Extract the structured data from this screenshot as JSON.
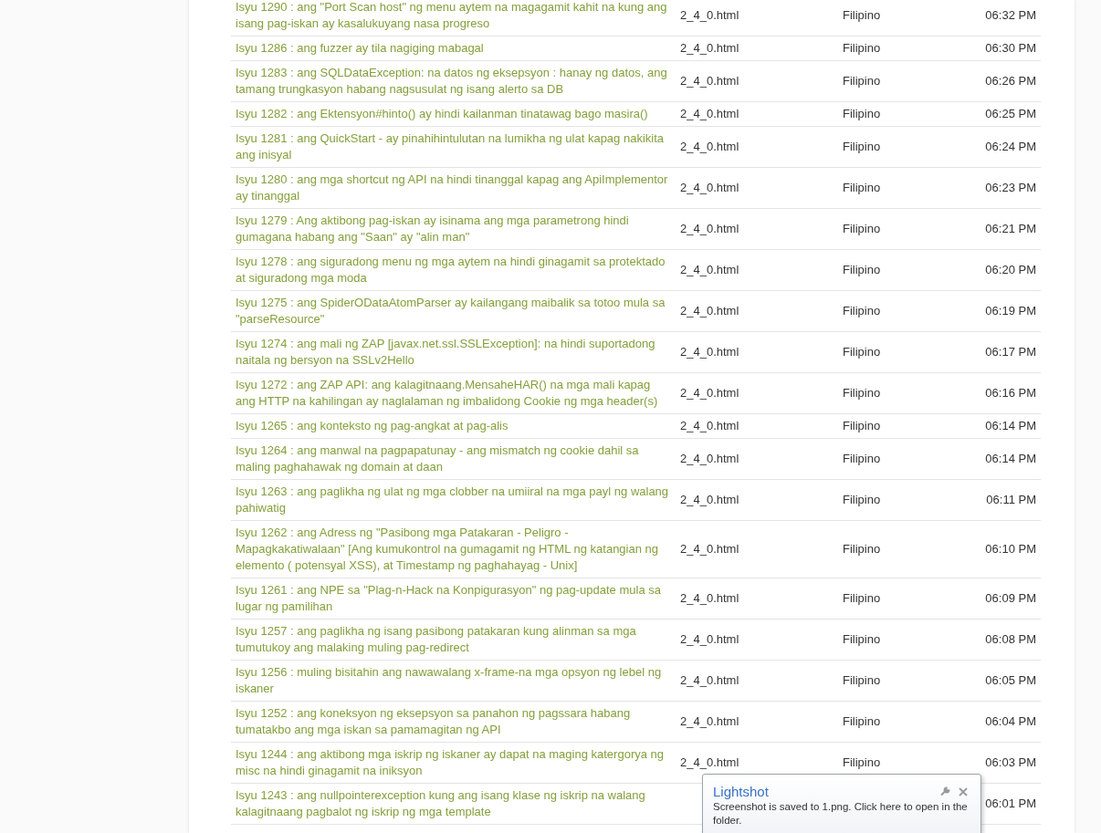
{
  "rows": [
    {
      "title": "Isyu 1290 : ang \"Port Scan host\" ng menu aytem na magagamit kahit na kung ang isang pag-iskan ay kasalukuyang nasa progreso",
      "file": "2_4_0.html",
      "language": "Filipino",
      "time": "06:32 PM"
    },
    {
      "title": "Isyu 1286 : ang fuzzer ay tila nagiging mabagal",
      "file": "2_4_0.html",
      "language": "Filipino",
      "time": "06:30 PM"
    },
    {
      "title": "Isyu 1283 : ang SQLDataException: na datos ng eksepsyon : hanay ng datos, ang tamang trungkasyon habang nagsusulat ng isang alerto sa DB",
      "file": "2_4_0.html",
      "language": "Filipino",
      "time": "06:26 PM"
    },
    {
      "title": "Isyu 1282 : ang Ektensyon#hinto() ay hindi kailanman tinatawag bago masira()",
      "file": "2_4_0.html",
      "language": "Filipino",
      "time": "06:25 PM"
    },
    {
      "title": "Isyu 1281 : ang QuickStart - ay pinahihintulutan na lumikha ng ulat kapag nakikita ang inisyal",
      "file": "2_4_0.html",
      "language": "Filipino",
      "time": "06:24 PM"
    },
    {
      "title": "Isyu 1280 : ang mga shortcut ng API na hindi tinanggal kapag ang ApiImplementor ay tinanggal",
      "file": "2_4_0.html",
      "language": "Filipino",
      "time": "06:23 PM"
    },
    {
      "title": "Isyu 1279 : Ang aktibong pag-iskan ay isinama ang mga parametrong hindi gumagana habang ang \"Saan\" ay \"alin man\"",
      "file": "2_4_0.html",
      "language": "Filipino",
      "time": "06:21 PM"
    },
    {
      "title": "Isyu 1278 : ang siguradong menu ng mga aytem na hindi ginagamit sa protektado at siguradong mga moda",
      "file": "2_4_0.html",
      "language": "Filipino",
      "time": "06:20 PM"
    },
    {
      "title": "Isyu 1275 : ang SpiderODataAtomParser ay kailangang maibalik sa totoo mula sa \"parseResource\"",
      "file": "2_4_0.html",
      "language": "Filipino",
      "time": "06:19 PM"
    },
    {
      "title": "Isyu 1274 : ang mali ng ZAP [javax.net.ssl.SSLException]: na hindi suportadong naitala ng bersyon na SSLv2Hello",
      "file": "2_4_0.html",
      "language": "Filipino",
      "time": "06:17 PM"
    },
    {
      "title": "Isyu 1272 : ang ZAP API: ang kalagitnaang.MensaheHAR() na mga mali kapag ang HTTP na kahilingan ay naglalaman ng imbalidong Cookie ng mga header(s)",
      "file": "2_4_0.html",
      "language": "Filipino",
      "time": "06:16 PM"
    },
    {
      "title": "Isyu 1265 : ang konteksto ng pag-angkat at pag-alis",
      "file": "2_4_0.html",
      "language": "Filipino",
      "time": "06:14 PM"
    },
    {
      "title": "Isyu 1264 : ang manwal na pagpapatunay - ang mismatch ng cookie dahil sa maling paghahawak ng domain at daan",
      "file": "2_4_0.html",
      "language": "Filipino",
      "time": "06:14 PM"
    },
    {
      "title": "Isyu 1263 : ang paglikha ng ulat ng mga clobber na umiiral na mga payl ng walang pahiwatig",
      "file": "2_4_0.html",
      "language": "Filipino",
      "time": "06:11 PM"
    },
    {
      "title": "Isyu 1262 : ang Adress ng \"Pasibong mga Patakaran - Peligro - Mapagkakatiwalaan\" [Ang kumukontrol na gumagamit ng HTML ng katangian ng elemento ( potensyal XSS), at Timestamp ng paghahayag - Unix]",
      "file": "2_4_0.html",
      "language": "Filipino",
      "time": "06:10 PM"
    },
    {
      "title": "Isyu 1261 : ang NPE sa \"Plag-n-Hack na Konpigurasyon\" ng pag-update mula sa lugar ng pamilihan",
      "file": "2_4_0.html",
      "language": "Filipino",
      "time": "06:09 PM"
    },
    {
      "title": "Isyu 1257 : ang paglikha ng isang pasibong patakaran kung alinman sa mga tumutukoy ang malaking muling pag-redirect",
      "file": "2_4_0.html",
      "language": "Filipino",
      "time": "06:08 PM"
    },
    {
      "title": "Isyu 1256 : muling bisitahin ang nawawalang x-frame-na mga opsyon ng lebel ng iskaner",
      "file": "2_4_0.html",
      "language": "Filipino",
      "time": "06:05 PM"
    },
    {
      "title": "Isyu 1252 : ang koneksyon ng eksepsyon sa panahon ng pagssara habang tumatakbo ang mga iskan sa pamamagitan ng API",
      "file": "2_4_0.html",
      "language": "Filipino",
      "time": "06:04 PM"
    },
    {
      "title": "Isyu 1244 : ang aktibong mga iskrip ng iskaner ay dapat na maging katergorya ng misc na hindi ginagamit na iniksyon",
      "file": "2_4_0.html",
      "language": "Filipino",
      "time": "06:03 PM"
    },
    {
      "title": "Isyu 1243 : ang nullpointerexception kung ang isang klase ng iskrip na walang kalagitnaang pagbalot ng iskrip ng mga template",
      "time": "06:01 PM"
    }
  ],
  "notification": {
    "title": "Lightshot",
    "message": "Screenshot is saved to 1.png. Click here to open in the folder."
  }
}
